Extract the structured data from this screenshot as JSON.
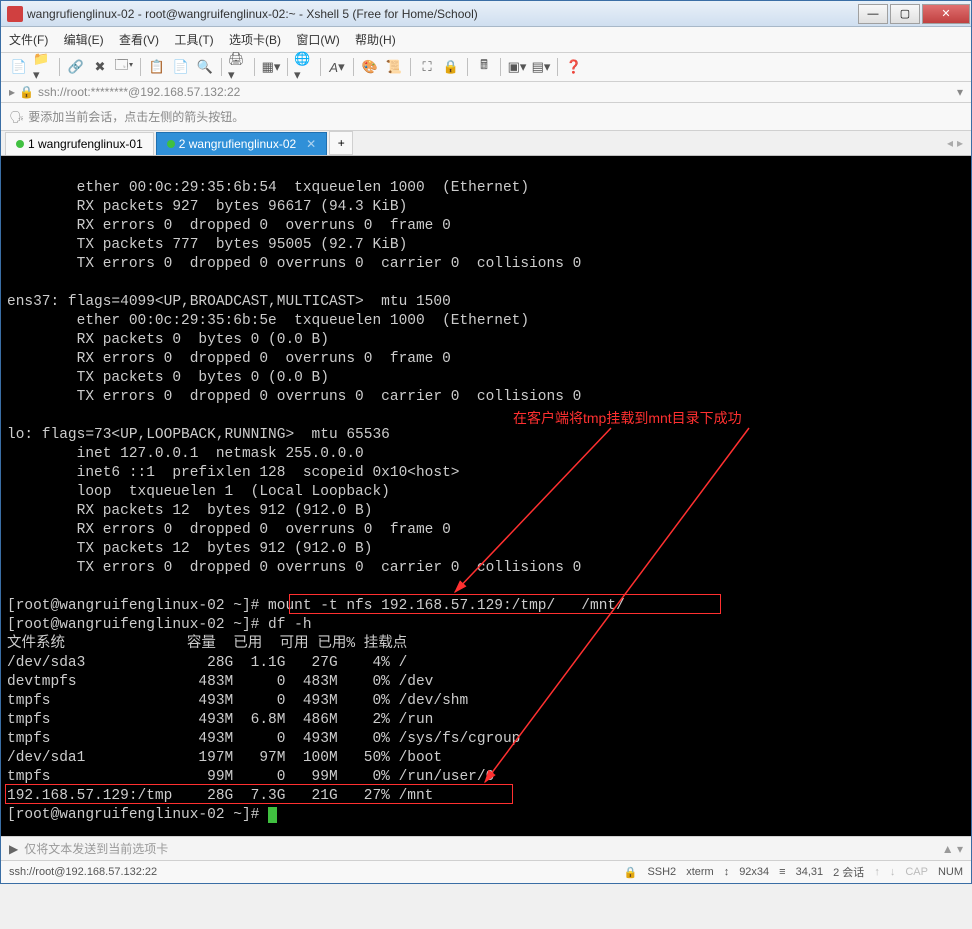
{
  "window": {
    "title": "wangrufienglinux-02 - root@wangruifenglinux-02:~ - Xshell 5 (Free for Home/School)",
    "min": "—",
    "max": "▢",
    "close": "✕"
  },
  "menu": {
    "file": "文件(F)",
    "edit": "编辑(E)",
    "view": "查看(V)",
    "tools": "工具(T)",
    "tabs": "选项卡(B)",
    "window": "窗口(W)",
    "help": "帮助(H)"
  },
  "addressbar": {
    "text": "ssh://root:********@192.168.57.132:22"
  },
  "infobar": {
    "text": "要添加当前会话，点击左侧的箭头按钮。"
  },
  "tabs": {
    "t1": "1 wangrufenglinux-01",
    "t2": "2 wangrufienglinux-02",
    "new": "+"
  },
  "terminal": {
    "l01": "        ether 00:0c:29:35:6b:54  txqueuelen 1000  (Ethernet)",
    "l02": "        RX packets 927  bytes 96617 (94.3 KiB)",
    "l03": "        RX errors 0  dropped 0  overruns 0  frame 0",
    "l04": "        TX packets 777  bytes 95005 (92.7 KiB)",
    "l05": "        TX errors 0  dropped 0 overruns 0  carrier 0  collisions 0",
    "l06": "",
    "l07": "ens37: flags=4099<UP,BROADCAST,MULTICAST>  mtu 1500",
    "l08": "        ether 00:0c:29:35:6b:5e  txqueuelen 1000  (Ethernet)",
    "l09": "        RX packets 0  bytes 0 (0.0 B)",
    "l10": "        RX errors 0  dropped 0  overruns 0  frame 0",
    "l11": "        TX packets 0  bytes 0 (0.0 B)",
    "l12": "        TX errors 0  dropped 0 overruns 0  carrier 0  collisions 0",
    "l13": "",
    "l14": "lo: flags=73<UP,LOOPBACK,RUNNING>  mtu 65536",
    "l15": "        inet 127.0.0.1  netmask 255.0.0.0",
    "l16": "        inet6 ::1  prefixlen 128  scopeid 0x10<host>",
    "l17": "        loop  txqueuelen 1  (Local Loopback)",
    "l18": "        RX packets 12  bytes 912 (912.0 B)",
    "l19": "        RX errors 0  dropped 0  overruns 0  frame 0",
    "l20": "        TX packets 12  bytes 912 (912.0 B)",
    "l21": "        TX errors 0  dropped 0 overruns 0  carrier 0  collisions 0",
    "l22": "",
    "l23a": "[root@wangruifenglinux-02 ~]# ",
    "l23b": "mount -t nfs 192.168.57.129:/tmp/   /mnt/",
    "l24": "[root@wangruifenglinux-02 ~]# df -h",
    "l25": "文件系统              容量  已用  可用 已用% 挂载点",
    "l26": "/dev/sda3              28G  1.1G   27G    4% /",
    "l27": "devtmpfs              483M     0  483M    0% /dev",
    "l28": "tmpfs                 493M     0  493M    0% /dev/shm",
    "l29": "tmpfs                 493M  6.8M  486M    2% /run",
    "l30": "tmpfs                 493M     0  493M    0% /sys/fs/cgroup",
    "l31": "/dev/sda1             197M   97M  100M   50% /boot",
    "l32": "tmpfs                  99M     0   99M    0% /run/user/0",
    "l33": "192.168.57.129:/tmp    28G  7.3G   21G   27% /mnt",
    "l34": "[root@wangruifenglinux-02 ~]# "
  },
  "annotation": {
    "text": "在客户端将tmp挂载到mnt目录下成功"
  },
  "sendbar": {
    "text": "仅将文本发送到当前选项卡"
  },
  "statusbar": {
    "conn": "ssh://root@192.168.57.132:22",
    "ssh": "SSH2",
    "term": "xterm",
    "size": "92x34",
    "pos": "34,31",
    "sessions": "2 会话",
    "cap": "CAP",
    "num": "NUM"
  }
}
